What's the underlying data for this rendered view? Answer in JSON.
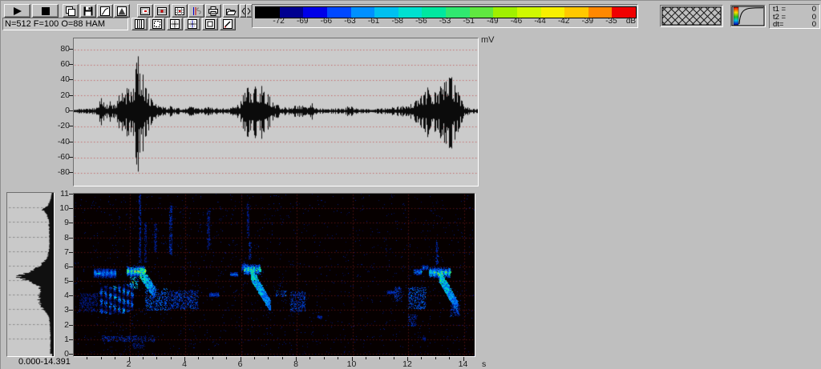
{
  "toolbar": {
    "params": "N=512 F=100 O=88 HAM",
    "row1_buttons": [
      "play-button",
      "stop-button",
      "copy-button",
      "save-button",
      "filter-curve-button",
      "envelope-button",
      "view-frame-button",
      "view-waterfall-button",
      "view-grid-button",
      "view-signal-button",
      "print-button",
      "open-button",
      "scroll-left-button",
      "scroll-right-button"
    ],
    "row2_buttons": [
      "view-columns-button",
      "view-dashed-frame-button",
      "view-grid-plus-button",
      "view-grid-plus-alt-button",
      "view-inner-frame-button",
      "edit-button"
    ]
  },
  "colorbar": {
    "unit": "dB",
    "colors": [
      "#000000",
      "#000090",
      "#0000e8",
      "#0048ff",
      "#0090ff",
      "#00c0f0",
      "#00e0d0",
      "#00e8a0",
      "#30e870",
      "#60e840",
      "#a0f000",
      "#d0f800",
      "#f8f000",
      "#ffc800",
      "#ff8800",
      "#f00000"
    ],
    "labels": [
      "-72",
      "-69",
      "-66",
      "-63",
      "-61",
      "-58",
      "-56",
      "-53",
      "-51",
      "-49",
      "-46",
      "-44",
      "-42",
      "-39",
      "-35"
    ]
  },
  "texture_panel": {
    "icon": "crosshatch-texture"
  },
  "transfer_panel": {
    "icon": "colormap-transfer-curve"
  },
  "time_panel": {
    "rows": [
      {
        "label": "t1 =",
        "value": "0"
      },
      {
        "label": "t2 =",
        "value": "0"
      },
      {
        "label": "dt=",
        "value": "0"
      }
    ]
  },
  "waveform": {
    "unit": "mV",
    "y_ticks": [
      80,
      60,
      40,
      20,
      0,
      -20,
      -40,
      -60,
      -80
    ],
    "grid_color": "#c46a6a"
  },
  "spectrogram": {
    "f_ticks": [
      11,
      10,
      9,
      8,
      7,
      6,
      5,
      4,
      3,
      2,
      1,
      0
    ],
    "t_ticks": [
      2,
      4,
      6,
      8,
      10,
      12,
      14
    ],
    "t_unit": "s",
    "grid_color": "#5c1414"
  },
  "spectrum_panel": {
    "range_label": "0.000-14.391"
  },
  "chart_data": [
    {
      "type": "line",
      "name": "oscillogram",
      "x_unit": "s",
      "y_unit": "mV",
      "x_range": [
        0,
        14.391
      ],
      "y_range": [
        -95,
        95
      ],
      "envelope_mv": [
        [
          0,
          2
        ],
        [
          0.2,
          3
        ],
        [
          0.4,
          3
        ],
        [
          0.6,
          4
        ],
        [
          0.8,
          6
        ],
        [
          0.9,
          14
        ],
        [
          1.0,
          19
        ],
        [
          1.1,
          12
        ],
        [
          1.2,
          9
        ],
        [
          1.3,
          14
        ],
        [
          1.42,
          9
        ],
        [
          1.52,
          12
        ],
        [
          1.62,
          24
        ],
        [
          1.72,
          32
        ],
        [
          1.82,
          20
        ],
        [
          1.9,
          36
        ],
        [
          2.0,
          42
        ],
        [
          2.08,
          30
        ],
        [
          2.18,
          48
        ],
        [
          2.28,
          92
        ],
        [
          2.36,
          55
        ],
        [
          2.45,
          68
        ],
        [
          2.52,
          42
        ],
        [
          2.62,
          30
        ],
        [
          2.72,
          20
        ],
        [
          2.85,
          13
        ],
        [
          3.0,
          9
        ],
        [
          3.15,
          7
        ],
        [
          3.3,
          6
        ],
        [
          3.45,
          8
        ],
        [
          3.6,
          5
        ],
        [
          3.8,
          4
        ],
        [
          4.0,
          5
        ],
        [
          4.2,
          7
        ],
        [
          4.4,
          4
        ],
        [
          4.6,
          4
        ],
        [
          4.8,
          6
        ],
        [
          5.0,
          4
        ],
        [
          5.2,
          5
        ],
        [
          5.4,
          4
        ],
        [
          5.6,
          5
        ],
        [
          5.8,
          8
        ],
        [
          5.95,
          12
        ],
        [
          6.1,
          26
        ],
        [
          6.22,
          36
        ],
        [
          6.32,
          28
        ],
        [
          6.45,
          38
        ],
        [
          6.58,
          32
        ],
        [
          6.72,
          41
        ],
        [
          6.85,
          34
        ],
        [
          6.95,
          28
        ],
        [
          7.05,
          20
        ],
        [
          7.15,
          12
        ],
        [
          7.3,
          9
        ],
        [
          7.45,
          7
        ],
        [
          7.6,
          5
        ],
        [
          7.8,
          6
        ],
        [
          8.0,
          8
        ],
        [
          8.15,
          9
        ],
        [
          8.3,
          6
        ],
        [
          8.45,
          4
        ],
        [
          8.55,
          18
        ],
        [
          8.65,
          5
        ],
        [
          8.85,
          4
        ],
        [
          9.1,
          3
        ],
        [
          9.4,
          4
        ],
        [
          9.7,
          3
        ],
        [
          9.9,
          9
        ],
        [
          10.05,
          4
        ],
        [
          10.3,
          3
        ],
        [
          10.6,
          3
        ],
        [
          10.9,
          4
        ],
        [
          11.2,
          4
        ],
        [
          11.5,
          6
        ],
        [
          11.75,
          7
        ],
        [
          12.0,
          9
        ],
        [
          12.2,
          13
        ],
        [
          12.4,
          19
        ],
        [
          12.6,
          28
        ],
        [
          12.75,
          36
        ],
        [
          12.9,
          30
        ],
        [
          13.05,
          26
        ],
        [
          13.2,
          41
        ],
        [
          13.35,
          46
        ],
        [
          13.5,
          52
        ],
        [
          13.62,
          42
        ],
        [
          13.75,
          30
        ],
        [
          13.88,
          18
        ],
        [
          14.0,
          9
        ],
        [
          14.15,
          5
        ],
        [
          14.39,
          3
        ]
      ]
    },
    {
      "type": "heatmap",
      "name": "spectrogram",
      "x_range": [
        0,
        14.391
      ],
      "y_range_khz": [
        0,
        11
      ],
      "marks_format": [
        "kind",
        "t_start",
        "t_end",
        "f_low_khz",
        "f_high_khz",
        "level_0_1"
      ],
      "noise": {
        "count": 1600,
        "level": 0.16
      },
      "marks": [
        [
          "patch",
          0.2,
          0.85,
          2.9,
          4.2,
          0.2
        ],
        [
          "bar",
          0.72,
          1.5,
          5.2,
          5.9,
          0.6
        ],
        [
          "dash",
          0.78,
          0.95,
          5.35,
          5.75,
          0.75
        ],
        [
          "stack",
          0.92,
          1.04,
          2.8,
          4.6,
          0.55
        ],
        [
          "stack",
          1.08,
          1.2,
          2.8,
          4.7,
          0.6
        ],
        [
          "stack",
          1.24,
          1.36,
          2.7,
          4.6,
          0.6
        ],
        [
          "stack",
          1.4,
          1.52,
          2.8,
          4.7,
          0.65
        ],
        [
          "stack",
          1.56,
          1.68,
          2.8,
          4.8,
          0.6
        ],
        [
          "stack",
          1.72,
          1.84,
          2.8,
          4.8,
          0.65
        ],
        [
          "stack",
          1.88,
          2.0,
          2.9,
          4.8,
          0.6
        ],
        [
          "stack",
          2.02,
          2.14,
          3.0,
          4.8,
          0.55
        ],
        [
          "bar",
          1.9,
          2.55,
          5.3,
          6.1,
          0.95
        ],
        [
          "patch",
          2.0,
          2.3,
          4.5,
          5.3,
          0.8
        ],
        [
          "tail",
          2.35,
          2.9,
          4.2,
          5.7,
          0.85
        ],
        [
          "patch",
          2.55,
          3.35,
          3.0,
          4.5,
          0.5
        ],
        [
          "patch",
          3.35,
          4.45,
          3.1,
          4.4,
          0.38
        ],
        [
          "dash",
          4.85,
          5.2,
          3.9,
          4.25,
          0.45
        ],
        [
          "vline",
          2.33,
          2.4,
          6.3,
          11,
          0.28
        ],
        [
          "vline",
          2.52,
          2.6,
          6.3,
          9.0,
          0.22
        ],
        [
          "vline",
          2.88,
          2.96,
          7.0,
          9.0,
          0.22
        ],
        [
          "vline",
          3.42,
          3.52,
          6.8,
          10.2,
          0.3
        ],
        [
          "vline",
          4.78,
          4.88,
          7.2,
          9.9,
          0.2
        ],
        [
          "patch",
          1.0,
          2.9,
          0.85,
          1.25,
          0.3
        ],
        [
          "patch",
          2.1,
          2.5,
          0.4,
          0.8,
          0.25
        ],
        [
          "dash",
          5.6,
          5.88,
          5.3,
          5.65,
          0.55
        ],
        [
          "dash",
          6.02,
          6.18,
          5.6,
          6.3,
          0.45
        ],
        [
          "bar",
          6.1,
          6.68,
          5.4,
          6.2,
          0.92
        ],
        [
          "tail",
          6.35,
          7.05,
          3.3,
          5.5,
          0.78
        ],
        [
          "vline",
          6.28,
          6.36,
          6.5,
          7.7,
          0.3
        ],
        [
          "vline",
          6.2,
          6.28,
          8.0,
          10.4,
          0.2
        ],
        [
          "patch",
          7.25,
          7.62,
          3.95,
          4.35,
          0.55
        ],
        [
          "patch",
          7.75,
          8.3,
          2.9,
          4.3,
          0.4
        ],
        [
          "dash",
          8.75,
          8.9,
          2.4,
          2.7,
          0.3
        ],
        [
          "dash",
          11.25,
          11.5,
          4.1,
          4.4,
          0.4
        ],
        [
          "patch",
          11.5,
          11.78,
          3.6,
          4.6,
          0.35
        ],
        [
          "patch",
          12.0,
          12.62,
          3.1,
          4.6,
          0.5
        ],
        [
          "patch",
          12.0,
          12.3,
          1.9,
          2.7,
          0.3
        ],
        [
          "dash",
          12.2,
          12.48,
          5.4,
          5.9,
          0.6
        ],
        [
          "dash",
          12.5,
          12.72,
          5.75,
          6.15,
          0.5
        ],
        [
          "bar",
          12.75,
          13.5,
          5.2,
          6.0,
          0.92
        ],
        [
          "tail",
          13.1,
          13.78,
          3.2,
          5.4,
          0.8
        ],
        [
          "vline",
          12.98,
          13.06,
          6.2,
          7.7,
          0.28
        ],
        [
          "patch",
          13.5,
          13.85,
          2.6,
          3.4,
          0.35
        ],
        [
          "dash",
          12.5,
          12.62,
          0.9,
          1.2,
          0.25
        ]
      ]
    },
    {
      "type": "area",
      "name": "average-spectrum",
      "profile_khz_fraction": [
        [
          0,
          0.06
        ],
        [
          1,
          0.06
        ],
        [
          2,
          0.07
        ],
        [
          2.4,
          0.09
        ],
        [
          2.7,
          0.14
        ],
        [
          3,
          0.22
        ],
        [
          3.3,
          0.3
        ],
        [
          3.7,
          0.33
        ],
        [
          4,
          0.32
        ],
        [
          4.3,
          0.3
        ],
        [
          4.6,
          0.33
        ],
        [
          4.8,
          0.45
        ],
        [
          5.0,
          0.6
        ],
        [
          5.2,
          0.78
        ],
        [
          5.35,
          0.8
        ],
        [
          5.5,
          0.65
        ],
        [
          5.7,
          0.5
        ],
        [
          5.9,
          0.38
        ],
        [
          6.1,
          0.28
        ],
        [
          6.4,
          0.18
        ],
        [
          6.7,
          0.12
        ],
        [
          7,
          0.1
        ],
        [
          7.5,
          0.08
        ],
        [
          8,
          0.08
        ],
        [
          8.6,
          0.09
        ],
        [
          9.2,
          0.1
        ],
        [
          9.6,
          0.16
        ],
        [
          9.9,
          0.26
        ],
        [
          10.1,
          0.14
        ],
        [
          10.5,
          0.06
        ],
        [
          11,
          0.03
        ]
      ]
    }
  ]
}
